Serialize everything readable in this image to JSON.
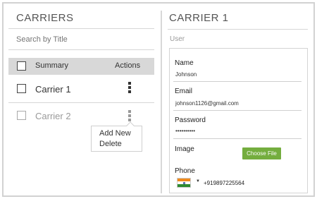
{
  "carriers_panel": {
    "title": "CARRIERS",
    "search_placeholder": "Search by Title",
    "table_header": {
      "summary": "Summary",
      "actions": "Actions"
    },
    "rows": [
      {
        "label": "Carrier 1",
        "state": "normal"
      },
      {
        "label": "Carrier 2",
        "state": "dimmed"
      }
    ],
    "actions_menu": {
      "items": [
        "Add New",
        "Delete"
      ]
    }
  },
  "detail_panel": {
    "title": "CARRIER 1",
    "section_label": "User",
    "fields": {
      "name": {
        "label": "Name",
        "value": "Johnson"
      },
      "email": {
        "label": "Email",
        "value": "johnson1126@gmail.com"
      },
      "password": {
        "label": "Password",
        "value": "••••••••••"
      },
      "image": {
        "label": "Image",
        "button": "Choose File"
      },
      "phone": {
        "label": "Phone",
        "value": "+919897225564",
        "flag": "india-flag-icon"
      }
    }
  },
  "colors": {
    "header_bg": "#d8d8d8",
    "choose_file_bg": "#74ad3e",
    "border": "#d2d2d2"
  }
}
